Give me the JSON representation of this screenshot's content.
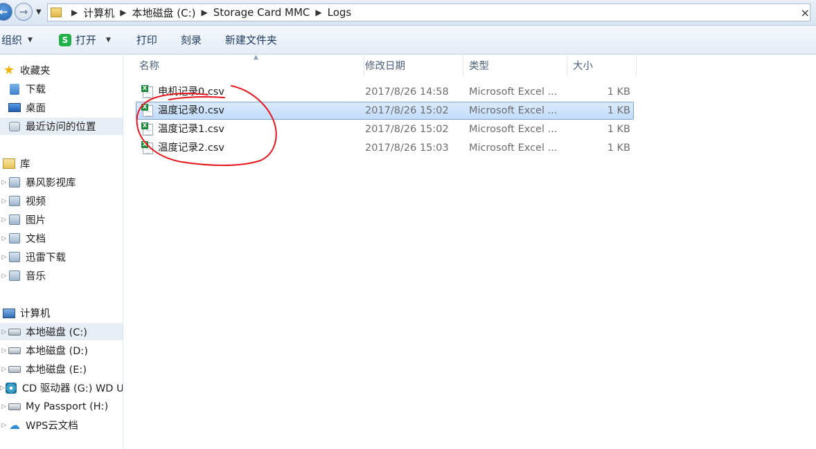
{
  "address_bar": {
    "back_glyph": "←",
    "forward_glyph": "→",
    "dropdown_glyph": "▼",
    "breadcrumbs": [
      "计算机",
      "本地磁盘 (C:)",
      "Storage Card MMC",
      "Logs"
    ],
    "separator": "▶",
    "close_glyph": "×"
  },
  "toolbar": {
    "organize": "组织",
    "open_icon_letter": "S",
    "open": "打开",
    "print": "打印",
    "burn": "刻录",
    "new_folder": "新建文件夹",
    "caret": "▼"
  },
  "nav": {
    "arrow": "▷",
    "favorites": {
      "label": "收藏夹",
      "icon": "star-icon",
      "glyph": "★"
    },
    "favorite_items": [
      {
        "label": "下载",
        "icon": "download-folder-icon"
      },
      {
        "label": "桌面",
        "icon": "desktop-icon"
      },
      {
        "label": "最近访问的位置",
        "icon": "recent-places-icon"
      }
    ],
    "libraries": {
      "label": "库",
      "icon": "library-icon"
    },
    "library_items": [
      {
        "label": "暴风影视库",
        "icon": "video-library-icon"
      },
      {
        "label": "视频",
        "icon": "video-icon"
      },
      {
        "label": "图片",
        "icon": "pictures-icon"
      },
      {
        "label": "文档",
        "icon": "documents-icon"
      },
      {
        "label": "迅雷下载",
        "icon": "thunder-download-icon"
      },
      {
        "label": "音乐",
        "icon": "music-icon"
      }
    ],
    "computer": {
      "label": "计算机",
      "icon": "computer-icon"
    },
    "computer_items": [
      {
        "label": "本地磁盘 (C:)",
        "icon": "drive-c-icon"
      },
      {
        "label": "本地磁盘 (D:)",
        "icon": "drive-icon"
      },
      {
        "label": "本地磁盘 (E:)",
        "icon": "drive-icon"
      },
      {
        "label": "CD 驱动器 (G:) WD U",
        "icon": "cd-drive-icon"
      },
      {
        "label": "My Passport (H:)",
        "icon": "drive-icon"
      },
      {
        "label": "WPS云文档",
        "icon": "cloud-icon",
        "glyph": "☁"
      }
    ]
  },
  "columns": {
    "name": "名称",
    "date": "修改日期",
    "type": "类型",
    "size": "大小",
    "sort_glyph": "▲"
  },
  "files": [
    {
      "name": "电机记录0.csv",
      "date": "2017/8/26 14:58",
      "type": "Microsoft Excel ...",
      "size": "1 KB"
    },
    {
      "name": "温度记录0.csv",
      "date": "2017/8/26 15:02",
      "type": "Microsoft Excel ...",
      "size": "1 KB"
    },
    {
      "name": "温度记录1.csv",
      "date": "2017/8/26 15:02",
      "type": "Microsoft Excel ...",
      "size": "1 KB"
    },
    {
      "name": "温度记录2.csv",
      "date": "2017/8/26 15:03",
      "type": "Microsoft Excel ...",
      "size": "1 KB"
    }
  ],
  "annotation_color": "#e8141b"
}
